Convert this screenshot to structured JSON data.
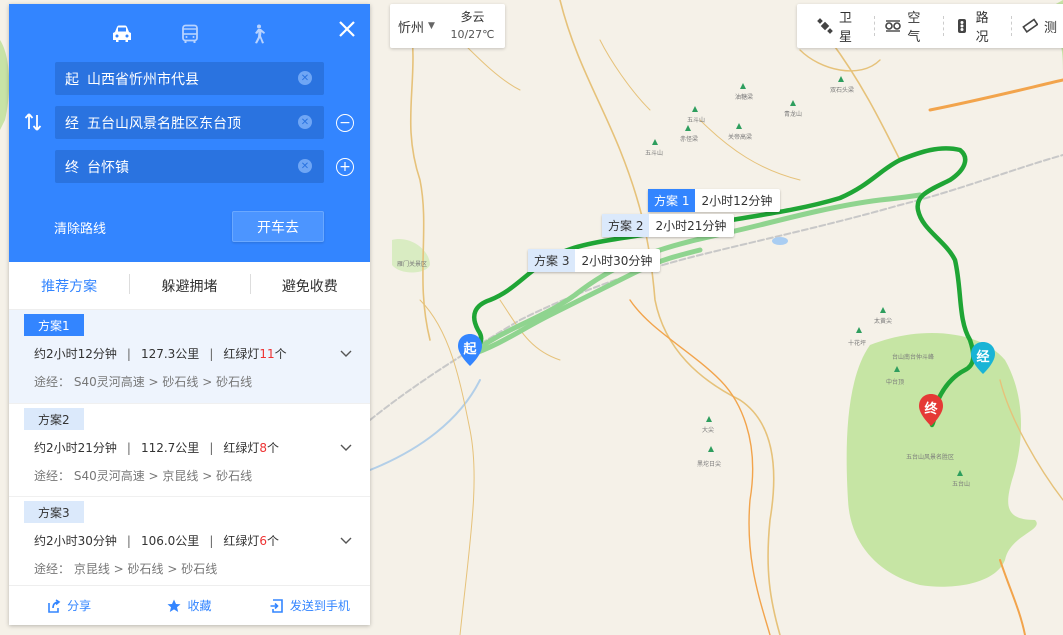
{
  "weather": {
    "city": "忻州",
    "condition": "多云",
    "temp": "10/27℃"
  },
  "tools": [
    {
      "label": "卫星",
      "icon": "satellite-icon"
    },
    {
      "label": "空气",
      "icon": "air-icon"
    },
    {
      "label": "路况",
      "icon": "traffic-light-icon"
    },
    {
      "label": "测",
      "icon": "ruler-icon"
    }
  ],
  "panel": {
    "modes": [
      "car-icon",
      "bus-icon",
      "walk-icon"
    ],
    "start": {
      "tag": "起",
      "value": "山西省忻州市代县"
    },
    "via": {
      "tag": "经",
      "value": "五台山风景名胜区东台顶"
    },
    "end": {
      "tag": "终",
      "value": "台怀镇"
    },
    "clear_label": "清除路线",
    "go_label": "开车去",
    "tabs": [
      "推荐方案",
      "躲避拥堵",
      "避免收费"
    ],
    "plans": [
      {
        "name": "方案1",
        "time": "约2小时12分钟",
        "distance": "127.3公里",
        "lights_label": "红绿灯",
        "lights": "11",
        "lights_unit": "个",
        "via_prefix": "途经：",
        "via": "S40灵河高速 > 砂石线 > 砂石线"
      },
      {
        "name": "方案2",
        "time": "约2小时21分钟",
        "distance": "112.7公里",
        "lights_label": "红绿灯",
        "lights": "8",
        "lights_unit": "个",
        "via_prefix": "途经：",
        "via": "S40灵河高速 > 京昆线 > 砂石线"
      },
      {
        "name": "方案3",
        "time": "约2小时30分钟",
        "distance": "106.0公里",
        "lights_label": "红绿灯",
        "lights": "6",
        "lights_unit": "个",
        "via_prefix": "途经：",
        "via": "京昆线 > 砂石线 > 砂石线"
      }
    ],
    "footer": {
      "share": "分享",
      "favorite": "收藏",
      "send": "发送到手机"
    }
  },
  "callouts": [
    {
      "name": "方案 1",
      "time": "2小时12分钟"
    },
    {
      "name": "方案 2",
      "time": "2小时21分钟"
    },
    {
      "name": "方案 3",
      "time": "2小时30分钟"
    }
  ],
  "pins": {
    "start": "起",
    "via": "经",
    "end": "终"
  },
  "map_labels": [
    "五斗山",
    "赤怪梁",
    "油糖梁",
    "青龙山",
    "双石头梁",
    "白林南",
    "关帝高梁",
    "十花坪",
    "太黄尖",
    "中台顶",
    "五台山风景名胜区",
    "五台山",
    "大尖",
    "黑坨日尖",
    "雁门关景区",
    "台山南台仲斗峰"
  ],
  "colors": {
    "primary": "#3385ff",
    "route_main": "#1fa535",
    "route_alt": "#8fd48f",
    "park_green": "#c2e3a1",
    "pin_start": "#3385ff",
    "pin_via": "#19b4d6",
    "pin_end": "#e53935"
  }
}
